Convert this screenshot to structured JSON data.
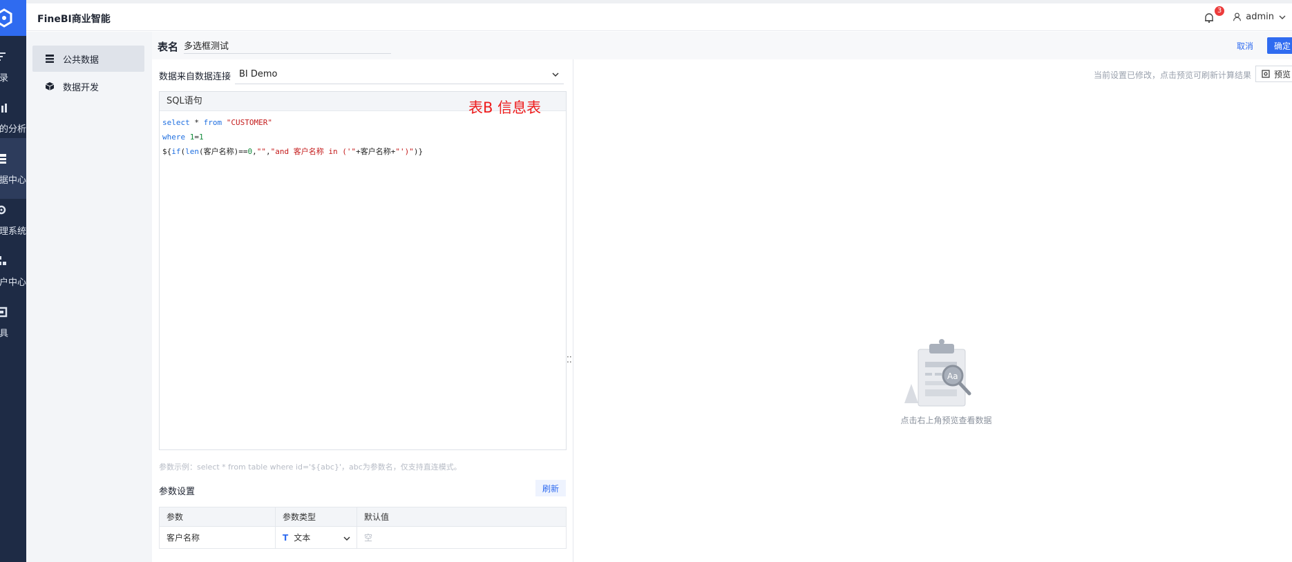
{
  "app": {
    "brand": "FineBI商业智能"
  },
  "rail": {
    "items": [
      {
        "label": "目录",
        "icon": "catalog-icon"
      },
      {
        "label": "我的分析",
        "icon": "analysis-icon"
      },
      {
        "label": "数据中心",
        "icon": "data-center-icon",
        "active": true
      },
      {
        "label": "管理系统",
        "icon": "system-icon"
      },
      {
        "label": "用户中心",
        "icon": "user-center-icon"
      },
      {
        "label": "工具",
        "icon": "tools-icon"
      }
    ]
  },
  "header": {
    "notifications": "3",
    "user": "admin"
  },
  "subnav": {
    "items": [
      {
        "label": "公共数据",
        "icon": "table-icon",
        "active": true
      },
      {
        "label": "数据开发",
        "icon": "cube-icon"
      }
    ]
  },
  "editor": {
    "table_name_label": "表名",
    "table_name_value": "多选框测试",
    "cancel_label": "取消",
    "confirm_label": "确定",
    "source_label": "数据来自数据连接",
    "source_value": "BI Demo",
    "sql_header": "SQL语句",
    "sql_annotation": "表B  信息表",
    "hint": "参数示例：select * from table where id='${abc}'，abc为参数名，仅支持直连模式。",
    "param_title": "参数设置",
    "refresh_label": "刷新",
    "param_columns": [
      "参数",
      "参数类型",
      "默认值"
    ],
    "params": [
      {
        "name": "客户名称",
        "type": "文本",
        "default_placeholder": "空"
      }
    ]
  },
  "preview": {
    "modified_tip": "当前设置已修改，点击预览可刷新计算结果",
    "preview_label": "预览",
    "empty_text": "点击右上角预览查看数据"
  },
  "colors": {
    "accent": "#2f6bf0",
    "rail": "#1e2b45",
    "annotation": "#ee1c1c"
  }
}
